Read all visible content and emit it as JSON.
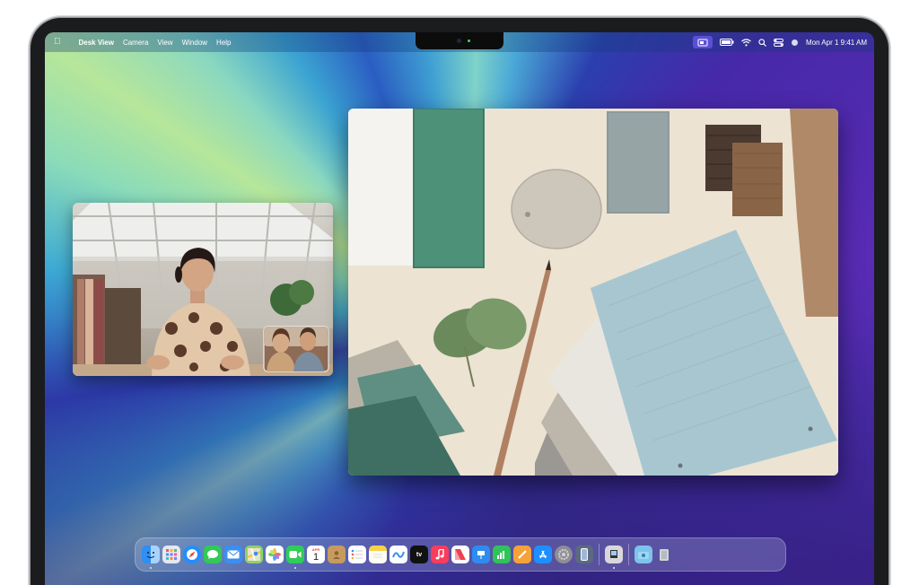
{
  "menubar": {
    "apple_icon": "apple-logo-icon",
    "app_name": "Desk View",
    "menus": [
      "Camera",
      "View",
      "Window",
      "Help"
    ],
    "datetime": "Mon Apr 1  9:41 AM",
    "status_icons": [
      "desk-view-icon",
      "battery-icon",
      "wifi-icon",
      "search-icon",
      "control-center-icon",
      "siri-icon"
    ]
  },
  "dock": {
    "calendar_month": "APR",
    "calendar_day": "1",
    "tv_label": "tv",
    "items": [
      "Finder",
      "Launchpad",
      "Safari",
      "Messages",
      "Mail",
      "Maps",
      "Photos",
      "FaceTime",
      "Calendar",
      "Contacts",
      "Reminders",
      "Notes",
      "Freeform",
      "TV",
      "Music",
      "News",
      "Keynote",
      "Numbers",
      "Pages",
      "App Store",
      "System Settings",
      "iPhone Mirroring",
      "Preview",
      "Downloads",
      "Trash"
    ]
  },
  "colors": {
    "deskview_accent": "#5b4fd6",
    "facetime_green": "#2fce56",
    "safari_blue": "#1f8fff"
  }
}
